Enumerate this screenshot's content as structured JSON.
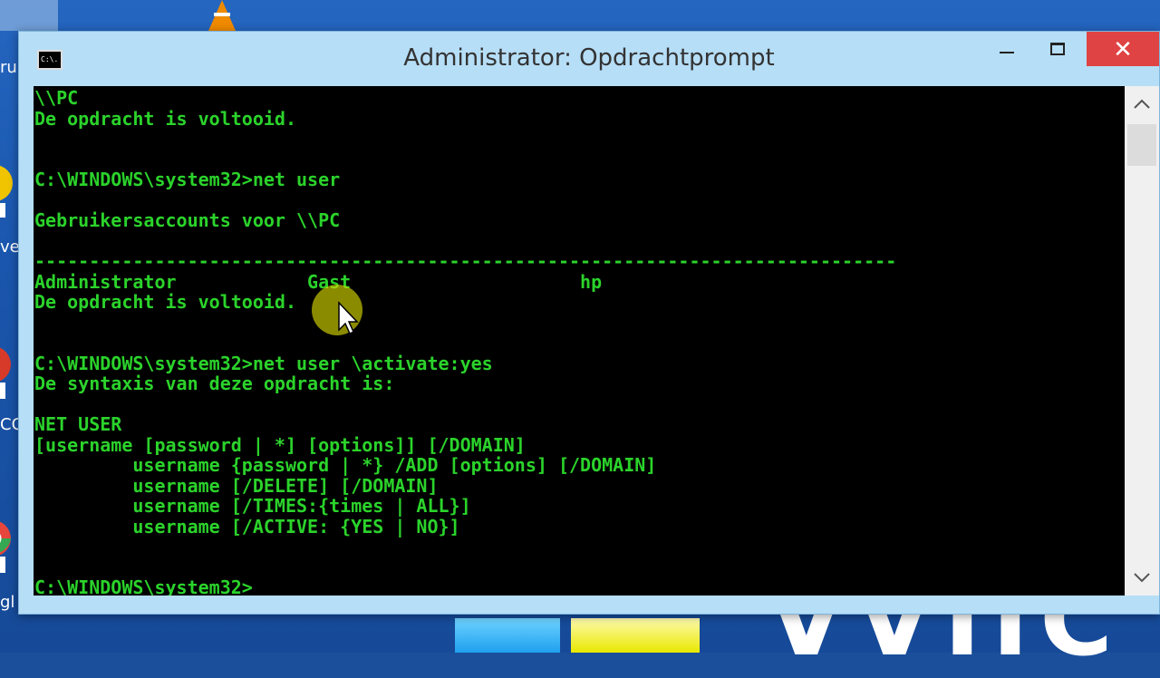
{
  "desktop": {
    "labels": [
      "ru",
      "ve",
      "CC",
      "gl"
    ]
  },
  "window": {
    "title": "Administrator: Opdrachtprompt",
    "icon_text": "C:\\."
  },
  "console": {
    "lines": [
      "\\\\PC",
      "De opdracht is voltooid.",
      "",
      "",
      "C:\\WINDOWS\\system32>net user",
      "",
      "Gebruikersaccounts voor \\\\PC",
      "",
      "-------------------------------------------------------------------------------",
      "Administrator            Gast                     hp",
      "De opdracht is voltooid.",
      "",
      "",
      "C:\\WINDOWS\\system32>net user \\activate:yes",
      "De syntaxis van deze opdracht is:",
      "",
      "NET USER",
      "[username [password | *] [options]] [/DOMAIN]",
      "         username {password | *} /ADD [options] [/DOMAIN]",
      "         username [/DELETE] [/DOMAIN]",
      "         username [/TIMES:{times | ALL}]",
      "         username [/ACTIVE: {YES | NO}]",
      "",
      "",
      "C:\\WINDOWS\\system32>"
    ]
  },
  "colors": {
    "console_text": "#2bd32b",
    "console_bg": "#000000",
    "titlebar": "#b6def7",
    "close_button": "#e04343"
  }
}
